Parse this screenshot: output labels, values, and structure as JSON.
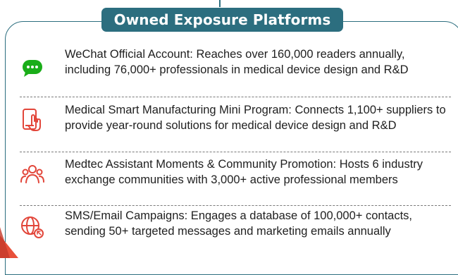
{
  "title": "Owned Exposure Platforms",
  "items": [
    {
      "icon": "wechat-chat-bubble-icon",
      "text": "WeChat Official Account: Reaches over 160,000 readers annually, including 76,000+ professionals in medical device design and R&D"
    },
    {
      "icon": "touch-tablet-icon",
      "text": "Medical Smart Manufacturing Mini Program: Connects 1,100+ suppliers to provide year-round solutions for medical device design and R&D"
    },
    {
      "icon": "community-people-icon",
      "text": "Medtec Assistant Moments & Community Promotion: Hosts 6 industry exchange communities with 3,000+ active professional members"
    },
    {
      "icon": "globe-cursor-icon",
      "text": "SMS/Email Campaigns: Engages a database of 100,000+ contacts, sending 50+ targeted messages and marketing emails annually"
    }
  ],
  "colors": {
    "frame": "#2c6e7f",
    "icon": "#e2463a",
    "wechat": "#1aad19",
    "accent": "#e8503a"
  }
}
